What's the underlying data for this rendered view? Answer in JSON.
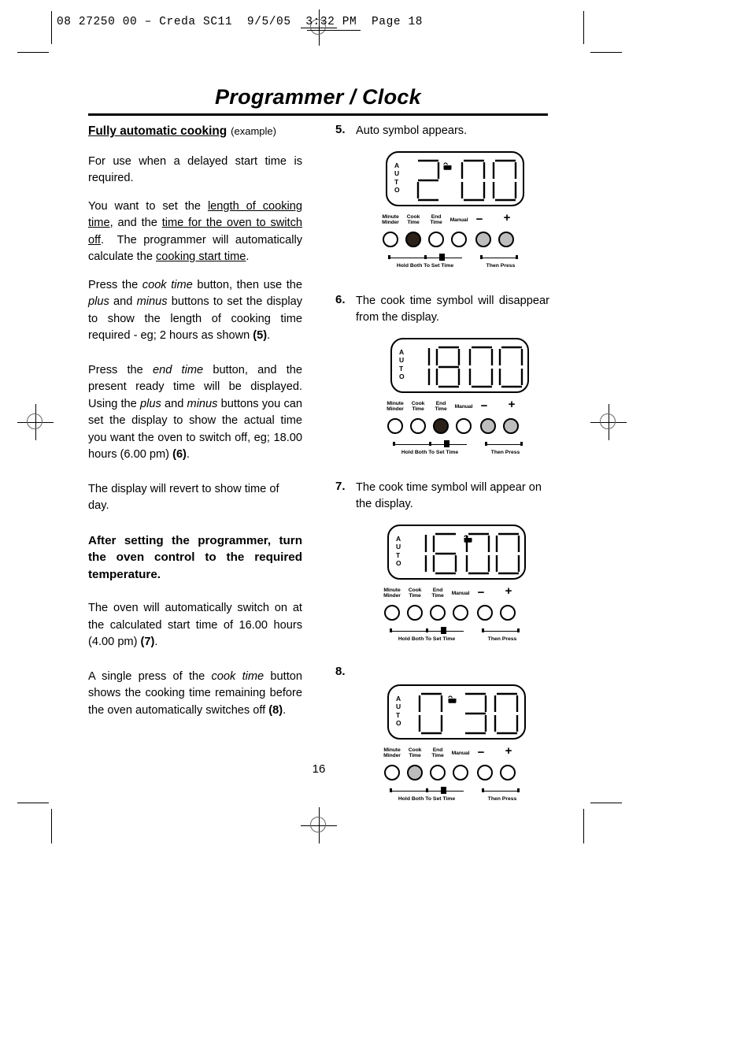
{
  "print_slug": "08 27250 00 – Creda SC11  9/5/05  3:32 PM  Page 18",
  "page": {
    "title": "Programmer / Clock",
    "folio": "16"
  },
  "left_column": {
    "section_heading": "Fully automatic cooking",
    "section_heading_note": "(example)",
    "paragraphs": [
      "For use when a delayed start time is required.",
      "You want to set the length of cooking time, and the time for the oven to switch off.  The programmer will automatically calculate the cooking start time.",
      "Press the cook time button, then use the plus and minus buttons to set the display to show the length of cooking time required - eg; 2 hours as shown (5).",
      "Press the end time button, and the present ready time will be displayed. Using the plus and minus buttons you can set the display to show the actual time you want the oven to switch off, eg; 18.00 hours (6.00 pm) (6).",
      "The display will revert to show time of day."
    ],
    "bold_block": "After setting the programmer, turn the oven control to the required temperature.",
    "paragraphs_after": [
      "The oven will automatically switch on at the calculated start time of 16.00 hours (4.00 pm) (7).",
      "A single press of the cook time button shows the cooking time remaining before the oven automatically switches off (8)."
    ]
  },
  "right_column": {
    "steps": [
      {
        "number": "5.",
        "text": "Auto symbol appears.",
        "display": {
          "auto_indicator": "AUTO",
          "reading": "2.00",
          "digits": [
            "2",
            "",
            "0",
            "0"
          ],
          "cook_symbol_visible": true,
          "cook_symbol_name": "cook-pot-icon"
        },
        "buttons": [
          {
            "label": "Minute\nMinder",
            "state": "white"
          },
          {
            "label": "Cook\nTime",
            "state": "dark"
          },
          {
            "label": "End\nTime",
            "state": "white"
          },
          {
            "label": "Manual",
            "state": "white"
          },
          {
            "label": "−",
            "state": "gray"
          },
          {
            "label": "+",
            "state": "gray"
          }
        ],
        "captions": [
          "Hold Both To Set Time",
          "Then Press"
        ]
      },
      {
        "number": "6.",
        "text": "The cook time symbol will disappear from the display.",
        "display": {
          "auto_indicator": "AUTO",
          "reading": "18.00",
          "digits": [
            "1",
            "8",
            "0",
            "0"
          ],
          "cook_symbol_visible": false,
          "cook_symbol_name": "cook-pot-icon"
        },
        "buttons": [
          {
            "label": "Minute\nMinder",
            "state": "white"
          },
          {
            "label": "Cook\nTime",
            "state": "white"
          },
          {
            "label": "End\nTime",
            "state": "dark"
          },
          {
            "label": "Manual",
            "state": "white"
          },
          {
            "label": "−",
            "state": "gray"
          },
          {
            "label": "+",
            "state": "gray"
          }
        ],
        "captions": [
          "Hold Both To Set Time",
          "Then Press"
        ]
      },
      {
        "number": "7.",
        "text": "The cook time symbol will appear on the display.",
        "display": {
          "auto_indicator": "AUTO",
          "reading": "16.00",
          "digits": [
            "1",
            "6",
            "0",
            "0"
          ],
          "cook_symbol_visible": true,
          "cook_symbol_name": "cook-pot-icon"
        },
        "buttons": [
          {
            "label": "Minute\nMinder",
            "state": "white"
          },
          {
            "label": "Cook\nTime",
            "state": "white"
          },
          {
            "label": "End\nTime",
            "state": "white"
          },
          {
            "label": "Manual",
            "state": "white"
          },
          {
            "label": "−",
            "state": "white"
          },
          {
            "label": "+",
            "state": "white"
          }
        ],
        "captions": [
          "Hold Both To Set Time",
          "Then Press"
        ]
      },
      {
        "number": "8.",
        "text": "",
        "display": {
          "auto_indicator": "AUTO",
          "reading": "0.30",
          "digits": [
            "0",
            "",
            "3",
            "0"
          ],
          "cook_symbol_visible": true,
          "cook_symbol_name": "cook-pot-icon"
        },
        "buttons": [
          {
            "label": "Minute\nMinder",
            "state": "white"
          },
          {
            "label": "Cook\nTime",
            "state": "gray"
          },
          {
            "label": "End\nTime",
            "state": "white"
          },
          {
            "label": "Manual",
            "state": "white"
          },
          {
            "label": "−",
            "state": "white"
          },
          {
            "label": "+",
            "state": "white"
          }
        ],
        "captions": [
          "Hold Both To Set Time",
          "Then Press"
        ]
      }
    ]
  }
}
